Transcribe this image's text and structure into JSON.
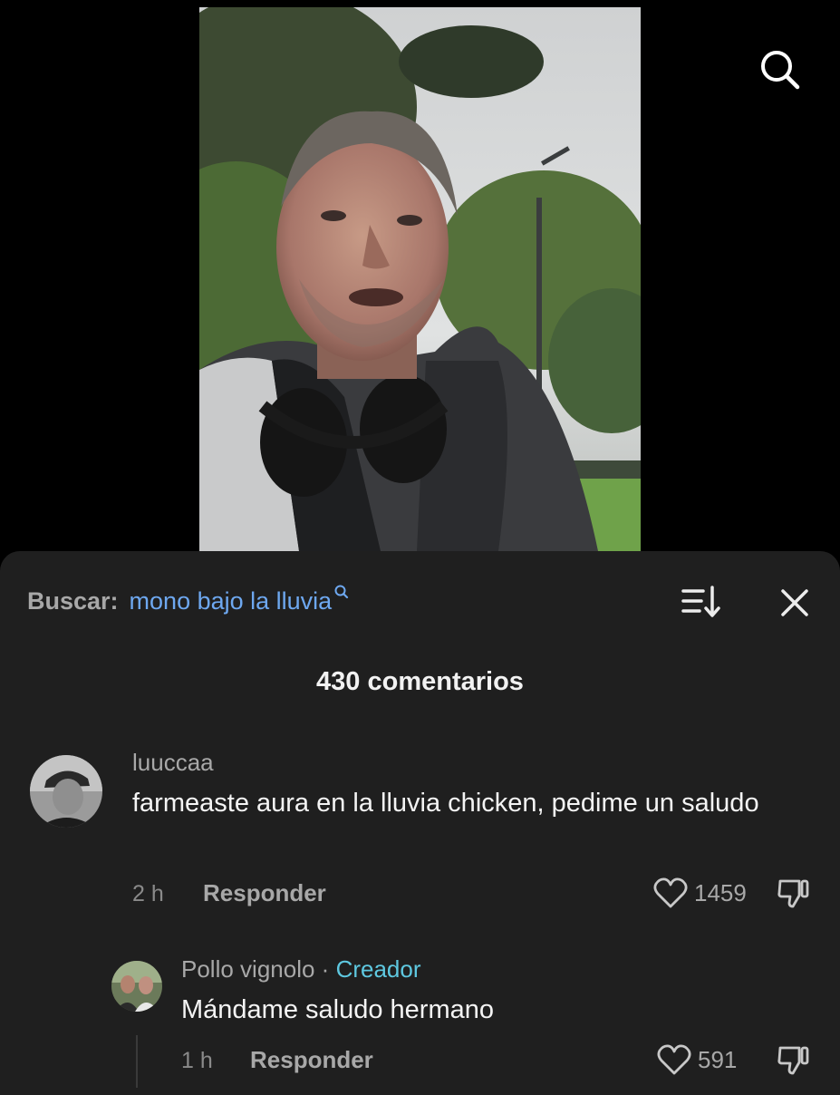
{
  "video": {
    "search_icon": "search-icon"
  },
  "panel": {
    "search_prefix": "Buscar:",
    "search_query": "mono bajo la lluvia",
    "sort_icon": "sort-icon",
    "close_icon": "close-icon",
    "comment_count": "430 comentarios"
  },
  "comments": [
    {
      "username": "luuccaa",
      "text": "farmeaste aura en la lluvia chicken, pedime un saludo",
      "time": "2 h",
      "reply_label": "Responder",
      "likes": "1459"
    }
  ],
  "reply": {
    "username": "Pollo vignolo",
    "separator": "·",
    "badge": "Creador",
    "text": "Mándame saludo hermano",
    "time": "1 h",
    "reply_label": "Responder",
    "likes": "591"
  },
  "colors": {
    "accent_link": "#6ea8f0",
    "creator_badge": "#5ec8e0",
    "panel_bg": "#1f1f1f"
  }
}
